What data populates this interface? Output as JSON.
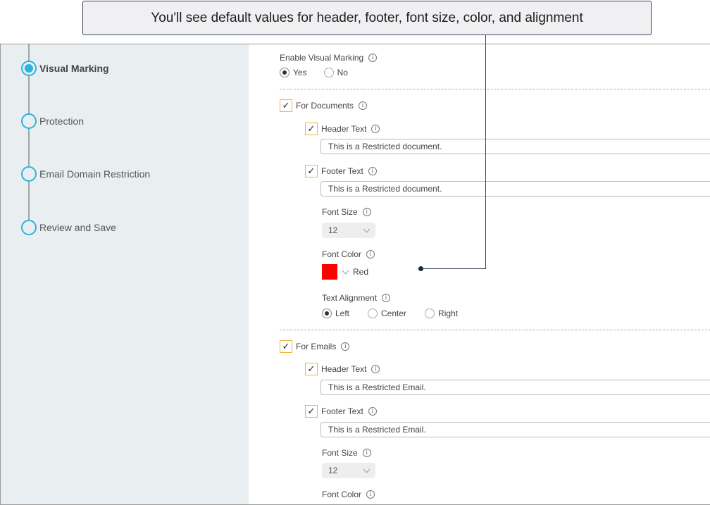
{
  "callout": {
    "text": "You'll see default values for header, footer, font size, color, and alignment"
  },
  "steps": [
    {
      "label": "Visual Marking",
      "active": true
    },
    {
      "label": "Protection",
      "active": false
    },
    {
      "label": "Email Domain Restriction",
      "active": false
    },
    {
      "label": "Review and Save",
      "active": false
    }
  ],
  "enable": {
    "label": "Enable Visual Marking",
    "options": [
      "Yes",
      "No"
    ],
    "selected": "Yes"
  },
  "documents": {
    "label": "For Documents",
    "checked": true,
    "header": {
      "label": "Header Text",
      "checked": true,
      "value": "This is a Restricted document."
    },
    "footer": {
      "label": "Footer Text",
      "checked": true,
      "value": "This is a Restricted document."
    },
    "font_size": {
      "label": "Font Size",
      "value": "12"
    },
    "font_color": {
      "label": "Font Color",
      "value": "Red",
      "swatch": "#ff0000"
    },
    "alignment": {
      "label": "Text Alignment",
      "options": [
        "Left",
        "Center",
        "Right"
      ],
      "selected": "Left"
    }
  },
  "emails": {
    "label": "For Emails",
    "checked": true,
    "header": {
      "label": "Header Text",
      "checked": true,
      "value": "This is a Restricted Email."
    },
    "footer": {
      "label": "Footer Text",
      "checked": true,
      "value": "This is a Restricted Email."
    },
    "font_size": {
      "label": "Font Size",
      "value": "12"
    },
    "font_color": {
      "label": "Font Color"
    }
  },
  "checkmark": "✓",
  "colors": {
    "accent": "#2ab4e0",
    "checkbox_border": "#f0b43c",
    "sidebar_bg": "#e9eff1"
  }
}
